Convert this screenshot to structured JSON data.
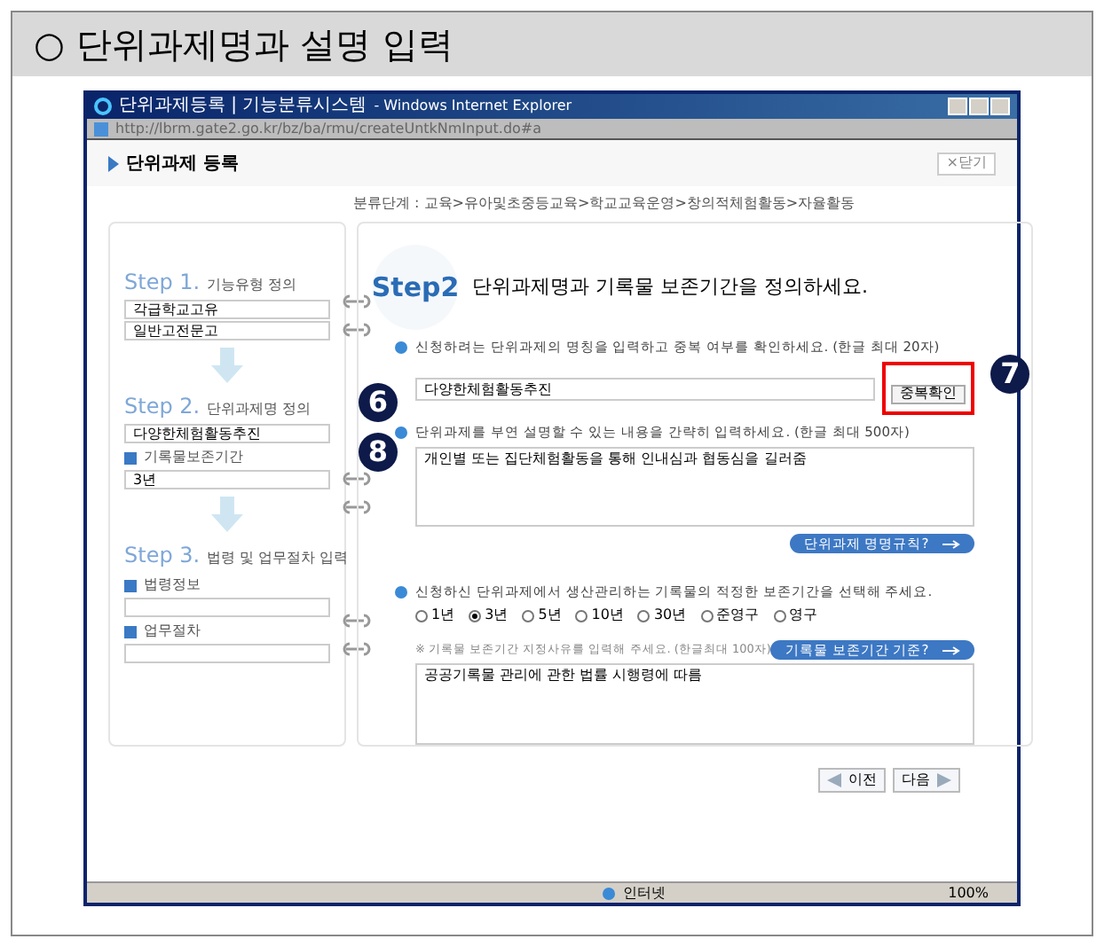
{
  "slide": {
    "title": "○ 단위과제명과 설명 입력"
  },
  "window": {
    "title": "단위과제등록 | 기능분류시스템",
    "app": "- Windows Internet Explorer",
    "address": "http://lbrm.gate2.go.kr/bz/ba/rmu/createUntkNmInput.do#a"
  },
  "page": {
    "heading": "단위과제 등록",
    "close_button": "×닫기",
    "breadcrumb": "분류단계 : 교육>유아및초중등교육>학교교육운영>창의적체험활동>자율활동"
  },
  "steps": [
    {
      "title": "Step 1.",
      "subtitle": "기능유형 정의",
      "fields": [
        {
          "value": "각급학교고유"
        },
        {
          "value": "일반고전문고"
        }
      ]
    },
    {
      "title": "Step 2.",
      "subtitle": "단위과제명 정의",
      "fields": [
        {
          "value": "다양한체험활동추진"
        },
        {
          "label": "기록물보존기간",
          "value": "3년"
        }
      ]
    },
    {
      "title": "Step 3.",
      "subtitle": "법령 및 업무절차 입력",
      "fields": [
        {
          "label": "법령정보"
        },
        {
          "label": "업무절차"
        }
      ]
    }
  ],
  "form": {
    "step_label": "Step2",
    "heading": "단위과제명과 기록물 보존기간을 정의하세요.",
    "name_prompt": "신청하려는 단위과제의 명칭을 입력하고 중복 여부를 확인하세요. (한글 최대 20자)",
    "name_value": "다양한체험활동추진",
    "check_button": "중복확인",
    "desc_prompt": "단위과제를 부연 설명할 수 있는 내용을 간략히 입력하세요. (한글 최대  500자)",
    "desc_value": "개인별 또는 집단체험활동을 통해 인내심과 협동심을 길러줌",
    "naming_rule_button": "단위과제 명명규칙?",
    "retention_prompt": "신청하신 단위과제에서 생산관리하는 기록물의 적정한 보존기간을 선택해 주세요.",
    "retention_options": [
      {
        "label": "1년",
        "selected": false
      },
      {
        "label": "3년",
        "selected": true
      },
      {
        "label": "5년",
        "selected": false
      },
      {
        "label": "10년",
        "selected": false
      },
      {
        "label": "30년",
        "selected": false
      },
      {
        "label": "준영구",
        "selected": false
      },
      {
        "label": "영구",
        "selected": false
      }
    ],
    "reason_hint": "※ 기록물 보존기간 지정사유를 입력해 주세요. (한글최대 100자)",
    "retention_rule_button": "기록물 보존기간 기준?",
    "reason_value": "공공기록물 관리에 관한 법률 시행령에 따름"
  },
  "nav": {
    "prev": "이전",
    "next": "다음"
  },
  "status_bar": {
    "zone": "인터넷",
    "zoom": "100%"
  },
  "callouts": [
    "6",
    "7",
    "8"
  ]
}
